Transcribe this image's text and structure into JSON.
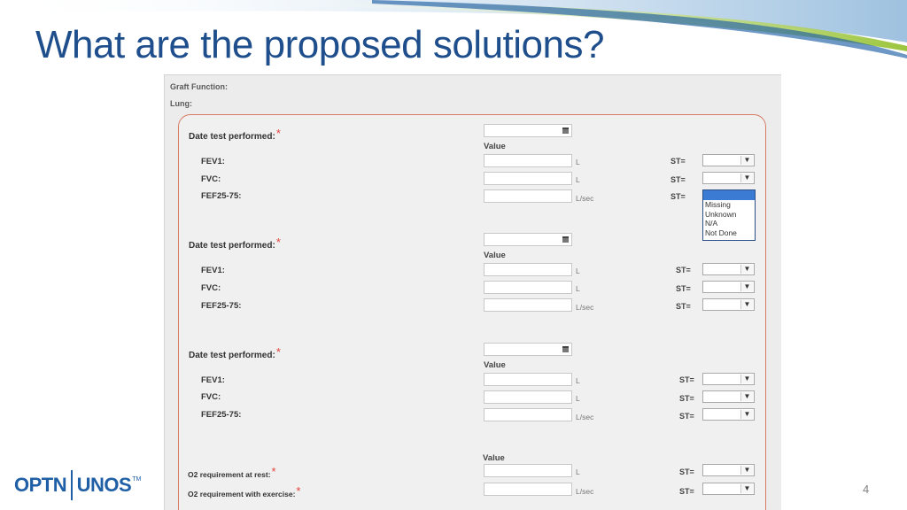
{
  "slide": {
    "title": "What are the proposed solutions?",
    "page_number": "4"
  },
  "logo": {
    "left": "OPTN",
    "right": "UNOS",
    "tm": "TM"
  },
  "form": {
    "section_label": "Graft Function:",
    "organ_label": "Lung:",
    "value_header": "Value",
    "required_mark": "*",
    "st_label": "ST=",
    "tests": [
      {
        "date_label": "Date test performed:",
        "rows": [
          {
            "label": "FEV1:",
            "unit": "L"
          },
          {
            "label": "FVC:",
            "unit": "L"
          },
          {
            "label": "FEF25-75:",
            "unit": "L/sec"
          }
        ]
      },
      {
        "date_label": "Date test performed:",
        "rows": [
          {
            "label": "FEV1:",
            "unit": "L"
          },
          {
            "label": "FVC:",
            "unit": "L"
          },
          {
            "label": "FEF25-75:",
            "unit": "L/sec"
          }
        ]
      },
      {
        "date_label": "Date test performed:",
        "rows": [
          {
            "label": "FEV1:",
            "unit": "L"
          },
          {
            "label": "FVC:",
            "unit": "L"
          },
          {
            "label": "FEF25-75:",
            "unit": "L/sec"
          }
        ]
      }
    ],
    "o2": {
      "rest_label": "O2 requirement at rest:",
      "rest_unit": "L",
      "exercise_label": "O2 requirement with exercise:",
      "exercise_unit": "L/sec"
    },
    "dropdown_options": [
      "Missing",
      "Unknown",
      "N/A",
      "Not Done"
    ]
  },
  "colors": {
    "title": "#1f4e8c",
    "panel_border": "#d97a63",
    "required": "#e2453c",
    "dropdown_highlight": "#3b7bd4"
  }
}
